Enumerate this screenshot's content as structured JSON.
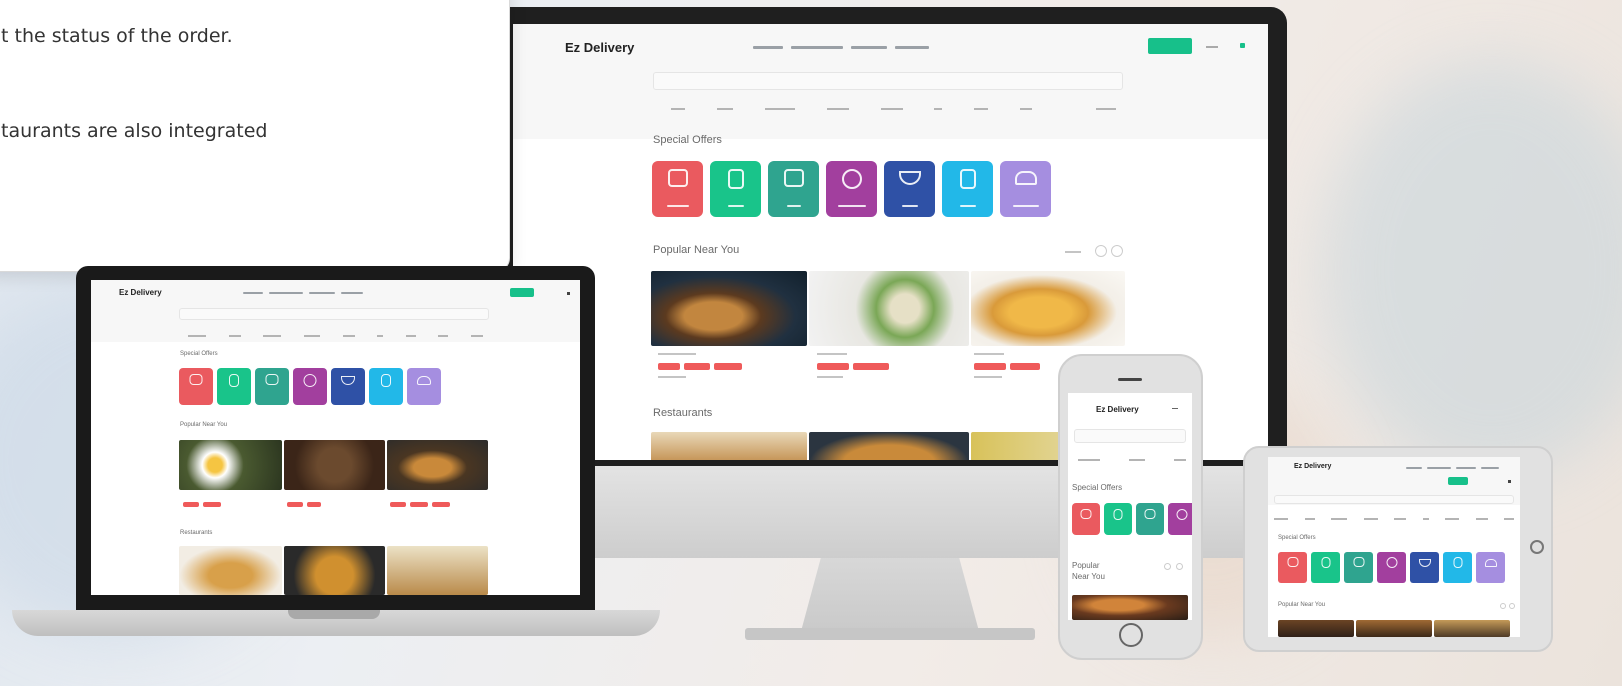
{
  "intro_text": {
    "line1": "t the status of the order.",
    "line2": "taurants are also integrated"
  },
  "brand_name": "Ez Delivery",
  "sections": {
    "special_offers": "Special Offers",
    "popular_near_you": "Popular Near You",
    "restaurants": "Restaurants"
  },
  "tile_colors": [
    "#ea5a5f",
    "#19c48a",
    "#2fa48f",
    "#a23f9e",
    "#2f51a6",
    "#22b8e8",
    "#a58ee0"
  ],
  "icons": [
    "scooter-icon",
    "cup-icon",
    "bus-icon",
    "dish-icon",
    "bowl-icon",
    "drink-icon",
    "burger-icon"
  ]
}
